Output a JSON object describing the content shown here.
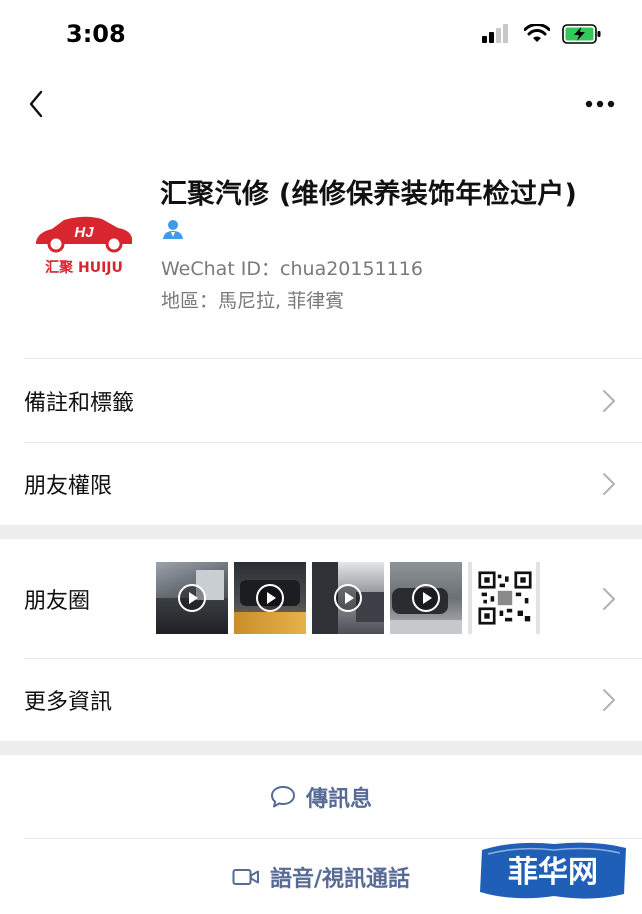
{
  "status_bar": {
    "time": "3:08",
    "icons": [
      "cellular-signal-icon",
      "wifi-icon",
      "battery-charging-icon"
    ],
    "battery_color": "#34c759"
  },
  "nav": {
    "back_icon": "chevron-left-icon",
    "more_icon": "ellipsis-icon"
  },
  "profile": {
    "avatar_logo_mark": "HJ",
    "avatar_logo_text": "汇聚 HUIJU",
    "name": "汇聚汽修 (维修保养装饰年检过户)",
    "verified_icon": "person-badge-icon",
    "wechat_id": "WeChat ID：chua20151116",
    "region": "地區：馬尼拉, 菲律賓",
    "brand_red": "#d8262e"
  },
  "rows": {
    "remarks_tags": "備註和標籤",
    "friend_permissions": "朋友權限",
    "moments": "朋友圈",
    "more_info": "更多資訊"
  },
  "moments_thumbnails": [
    {
      "kind": "video",
      "icon": "play-icon"
    },
    {
      "kind": "video",
      "icon": "play-icon"
    },
    {
      "kind": "video",
      "icon": "play-icon"
    },
    {
      "kind": "video",
      "icon": "play-icon"
    },
    {
      "kind": "image",
      "icon": "qr-code-icon"
    }
  ],
  "actions": {
    "send_message": "傳訊息",
    "voice_video_call": "語音/視訊通話",
    "accent_color": "#576b95"
  },
  "watermark": {
    "text": "菲华网",
    "color": "#1f5fb8"
  }
}
